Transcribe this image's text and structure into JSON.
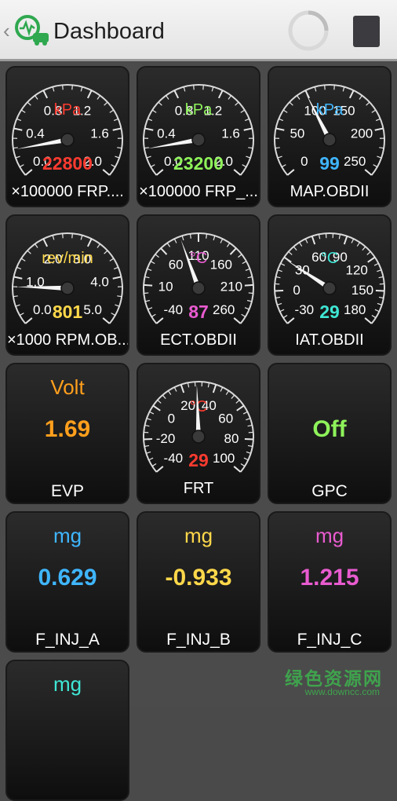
{
  "header": {
    "back_glyph": "‹",
    "title": "Dashboard",
    "spinner": "loading-indicator",
    "stop_button": "stop"
  },
  "gauges": [
    {
      "id": "frp1",
      "ticks": [
        "0.0",
        "0.4",
        "0.8",
        "1.2",
        "1.6",
        "2.0"
      ],
      "unit": "kPa",
      "unit_color": "#ff3b30",
      "value": "22800",
      "value_color": "#ff3b30",
      "name": "×100000 FRP....",
      "min": 0,
      "max": 2.0,
      "reading": 0.228
    },
    {
      "id": "frp2",
      "ticks": [
        "0.0",
        "0.4",
        "0.8",
        "1.2",
        "1.6",
        "2.0"
      ],
      "unit": "kPa",
      "unit_color": "#8ef25a",
      "value": "23200",
      "value_color": "#8ef25a",
      "name": "×100000 FRP_...",
      "min": 0,
      "max": 2.0,
      "reading": 0.232
    },
    {
      "id": "map",
      "ticks": [
        "0",
        "50",
        "100",
        "150",
        "200",
        "250"
      ],
      "unit": "kPa",
      "unit_color": "#3fb6ff",
      "value": "99",
      "value_color": "#3fb6ff",
      "name": "MAP.OBDII",
      "min": 0,
      "max": 250,
      "reading": 99
    },
    {
      "id": "rpm",
      "ticks": [
        "0.0",
        "1.0",
        "2.0",
        "3.0",
        "4.0",
        "5.0"
      ],
      "unit": "rev/min",
      "unit_color": "#ffd84a",
      "value": "801",
      "value_color": "#ffd84a",
      "name": "×1000 RPM.OB...",
      "min": 0,
      "max": 5.0,
      "reading": 0.801
    },
    {
      "id": "ect",
      "ticks": [
        "-40",
        "10",
        "60",
        "110",
        "160",
        "210",
        "260"
      ],
      "unit": "°C",
      "unit_color": "#e95bd0",
      "value": "87",
      "value_color": "#e95bd0",
      "name": "ECT.OBDII",
      "min": -40,
      "max": 260,
      "reading": 87
    },
    {
      "id": "iat",
      "ticks": [
        "-30",
        "0",
        "30",
        "60",
        "90",
        "120",
        "150",
        "180"
      ],
      "unit": "°C",
      "unit_color": "#3fe6d4",
      "value": "29",
      "value_color": "#3fe6d4",
      "name": "IAT.OBDII",
      "min": -30,
      "max": 180,
      "reading": 29
    },
    {
      "id": "frt",
      "ticks": [
        "-40",
        "-20",
        "0",
        "20",
        "40",
        "60",
        "80",
        "100"
      ],
      "unit": "°C",
      "unit_color": "#ff3b30",
      "value": "29",
      "value_color": "#ff3b30",
      "name": "FRT",
      "min": -40,
      "max": 100,
      "reading": 29
    }
  ],
  "tiles": [
    {
      "id": "evp",
      "unit": "Volt",
      "unit_color": "#ff9f1c",
      "value": "1.69",
      "value_color": "#ff9f1c",
      "name": "EVP"
    },
    {
      "id": "gpc",
      "unit": "",
      "unit_color": "#8ef25a",
      "value": "Off",
      "value_color": "#8ef25a",
      "name": "GPC"
    },
    {
      "id": "finja",
      "unit": "mg",
      "unit_color": "#3fb6ff",
      "value": "0.629",
      "value_color": "#3fb6ff",
      "name": "F_INJ_A"
    },
    {
      "id": "finjb",
      "unit": "mg",
      "unit_color": "#ffd84a",
      "value": "-0.933",
      "value_color": "#ffd84a",
      "name": "F_INJ_B"
    },
    {
      "id": "finjc",
      "unit": "mg",
      "unit_color": "#e95bd0",
      "value": "1.215",
      "value_color": "#e95bd0",
      "name": "F_INJ_C"
    },
    {
      "id": "finjd",
      "unit": "mg",
      "unit_color": "#3fe6d4",
      "value": "",
      "value_color": "#3fe6d4",
      "name": ""
    }
  ],
  "watermark": {
    "main": "绿色资源网",
    "sub": "www.downcc.com"
  }
}
